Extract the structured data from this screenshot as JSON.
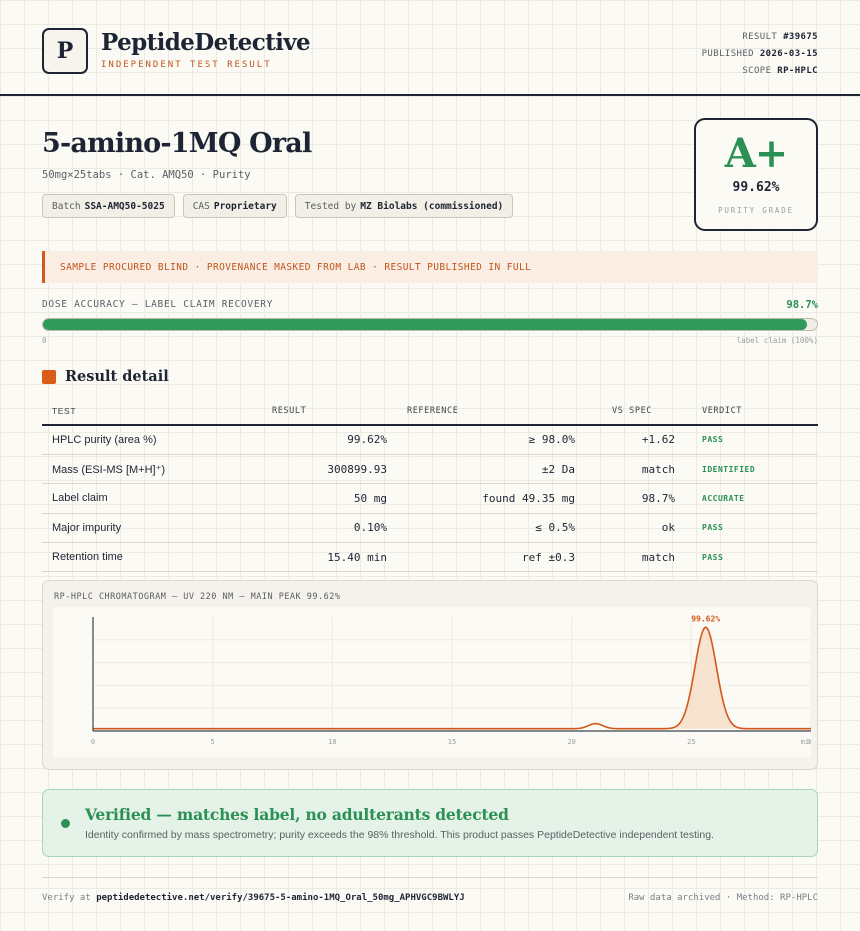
{
  "header": {
    "logo_letter": "P",
    "brand": "PeptideDetective",
    "brand_sub": "INDEPENDENT TEST RESULT",
    "meta": [
      {
        "key": "RESULT",
        "value": "#39675"
      },
      {
        "key": "PUBLISHED",
        "value": "2026-03-15"
      },
      {
        "key": "SCOPE",
        "value": "RP-HPLC"
      }
    ]
  },
  "product": {
    "title": "5-amino-1MQ Oral",
    "subtitle": "50mg×25tabs · Cat. AMQ50 · Purity",
    "chips": [
      {
        "label": "Batch",
        "value": "SSA-AMQ50-5025"
      },
      {
        "label": "CAS",
        "value": "Proprietary"
      },
      {
        "label": "Tested by",
        "value": "MZ Biolabs (commissioned)"
      }
    ]
  },
  "grade": {
    "letter": "A+",
    "value": "99.62%",
    "label": "PURITY GRADE",
    "color": "#2a9054"
  },
  "notice": "SAMPLE PROCURED BLIND · PROVENANCE MASKED FROM LAB · RESULT PUBLISHED IN FULL",
  "dose": {
    "label": "DOSE ACCURACY — LABEL CLAIM RECOVERY",
    "value_text": "98.7%",
    "fraction": 0.987,
    "min_label": "0",
    "max_label": "label claim (100%)"
  },
  "results": {
    "title": "Result detail",
    "headers": [
      "TEST",
      "RESULT",
      "REFERENCE",
      "VS SPEC",
      "VERDICT"
    ],
    "rows": [
      {
        "test": "HPLC purity (area %)",
        "result": "99.62%",
        "reference": "≥ 98.0%",
        "vs": "+1.62",
        "verdict": "PASS"
      },
      {
        "test": "Mass (ESI-MS [M+H]⁺)",
        "result": "300899.93",
        "reference": "±2 Da",
        "vs": "match",
        "verdict": "IDENTIFIED"
      },
      {
        "test": "Label claim",
        "result": "50 mg",
        "reference": "found 49.35 mg",
        "vs": "98.7%",
        "verdict": "ACCURATE"
      },
      {
        "test": "Major impurity",
        "result": "0.10%",
        "reference": "≤ 0.5%",
        "vs": "ok",
        "verdict": "PASS"
      },
      {
        "test": "Retention time",
        "result": "15.40 min",
        "reference": "ref ±0.3",
        "vs": "match",
        "verdict": "PASS"
      }
    ]
  },
  "chromatogram": {
    "title": "RP-HPLC CHROMATOGRAM — UV 220 NM — MAIN PEAK 99.62%",
    "peak_label": "99.62%"
  },
  "chart_data": {
    "type": "line",
    "title": "RP-HPLC CHROMATOGRAM — UV 220 NM — MAIN PEAK 99.62%",
    "xlabel": "",
    "ylabel": "",
    "x_ticks": [
      "0",
      "5",
      "10",
      "15",
      "20",
      "25",
      "30"
    ],
    "x_tick_values": [
      0,
      5,
      10,
      15,
      20,
      25,
      30
    ],
    "x_end_label": "min",
    "xlim": [
      0,
      30
    ],
    "ylim": [
      0,
      100
    ],
    "baseline": 2,
    "peaks": [
      {
        "x": 21.0,
        "height": 4.5,
        "width": 0.3
      },
      {
        "x": 25.6,
        "height": 89,
        "width": 0.45,
        "label": "99.62%"
      }
    ],
    "line_color": "#d4581a",
    "fill_color": "#f7dcc7"
  },
  "verified": {
    "title": "Verified — matches label, no adulterants detected",
    "subtitle": "Identity confirmed by mass spectrometry; purity exceeds the 98% threshold. This product passes PeptideDetective independent testing."
  },
  "footer": {
    "verify_prefix": "Verify at",
    "verify_url": "peptidedetective.net/verify/39675-5-amino-1MQ_Oral_50mg_APHVGC9BWLYJ",
    "right": "Raw data archived · Method: RP-HPLC"
  }
}
